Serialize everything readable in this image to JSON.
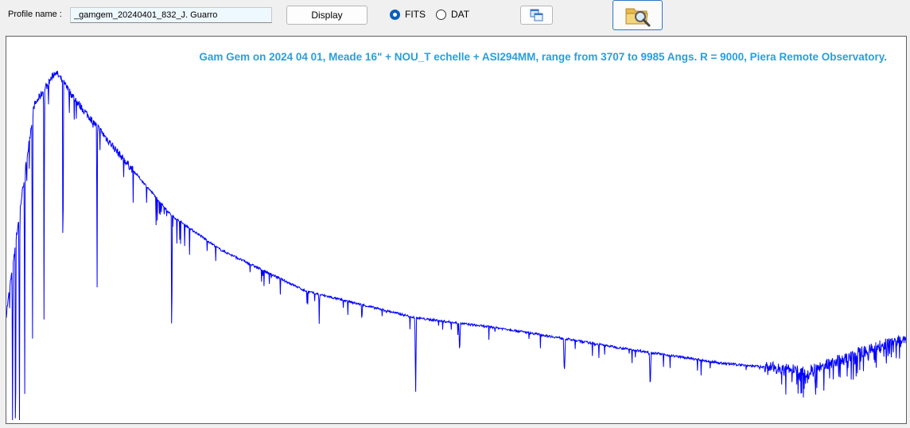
{
  "toolbar": {
    "profile_label": "Profile name :",
    "profile_value": "_gamgem_20240401_832_J. Guarro",
    "display_label": "Display",
    "format_options": [
      {
        "label": "FITS",
        "selected": true
      },
      {
        "label": "DAT",
        "selected": false
      }
    ],
    "icons": {
      "copy": "copy-windows-icon",
      "open": "folder-search-icon"
    }
  },
  "chart_data": {
    "type": "line",
    "title": "Gam Gem on 2024 04 01,  Meade 16\" + NOU_T echelle + ASI294MM, range  from 3707 to 9985 Angs. R = 9000, Piera Remote Observatory.",
    "x_range": [
      3707,
      9985
    ],
    "y_range": [
      0,
      1
    ],
    "grid": false,
    "series_color": "#0000ff",
    "continuum": [
      [
        3707,
        0.28
      ],
      [
        3800,
        0.55
      ],
      [
        3900,
        0.83
      ],
      [
        4050,
        0.92
      ],
      [
        4200,
        0.84
      ],
      [
        4500,
        0.7
      ],
      [
        4860,
        0.54
      ],
      [
        5200,
        0.45
      ],
      [
        5800,
        0.34
      ],
      [
        6563,
        0.27
      ],
      [
        7200,
        0.24
      ],
      [
        8000,
        0.19
      ],
      [
        8700,
        0.15
      ],
      [
        9300,
        0.13
      ],
      [
        9985,
        0.22
      ]
    ],
    "absorption_lines": [
      {
        "x": 3750,
        "depth": 0.72
      },
      {
        "x": 3771,
        "depth": 0.7
      },
      {
        "x": 3798,
        "depth": 0.68
      },
      {
        "x": 3835,
        "depth": 0.66
      },
      {
        "x": 3889,
        "depth": 0.72
      },
      {
        "x": 3970,
        "depth": 0.7
      },
      {
        "x": 4102,
        "depth": 0.62
      },
      {
        "x": 4340,
        "depth": 0.5
      },
      {
        "x": 4861,
        "depth": 0.42
      },
      {
        "x": 5890,
        "depth": 0.08
      },
      {
        "x": 6563,
        "depth": 0.2
      },
      {
        "x": 6870,
        "depth": 0.08
      },
      {
        "x": 7600,
        "depth": 0.08
      },
      {
        "x": 8200,
        "depth": 0.1
      }
    ]
  }
}
